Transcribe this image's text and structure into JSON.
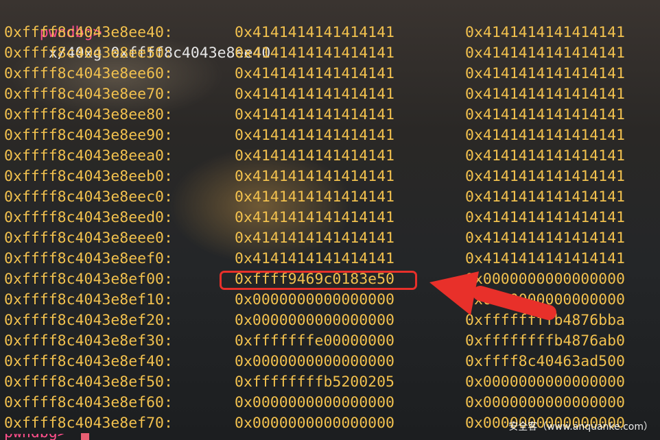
{
  "terminal": {
    "prompt": "pwndbg>",
    "command": "x/40xg 0xffff8c4043e8ee40",
    "rows": [
      {
        "addr": "0xffff8c4043e8ee40:",
        "v1": "0x4141414141414141",
        "v2": "0x4141414141414141"
      },
      {
        "addr": "0xffff8c4043e8ee50:",
        "v1": "0x4141414141414141",
        "v2": "0x4141414141414141"
      },
      {
        "addr": "0xffff8c4043e8ee60:",
        "v1": "0x4141414141414141",
        "v2": "0x4141414141414141"
      },
      {
        "addr": "0xffff8c4043e8ee70:",
        "v1": "0x4141414141414141",
        "v2": "0x4141414141414141"
      },
      {
        "addr": "0xffff8c4043e8ee80:",
        "v1": "0x4141414141414141",
        "v2": "0x4141414141414141"
      },
      {
        "addr": "0xffff8c4043e8ee90:",
        "v1": "0x4141414141414141",
        "v2": "0x4141414141414141"
      },
      {
        "addr": "0xffff8c4043e8eea0:",
        "v1": "0x4141414141414141",
        "v2": "0x4141414141414141"
      },
      {
        "addr": "0xffff8c4043e8eeb0:",
        "v1": "0x4141414141414141",
        "v2": "0x4141414141414141"
      },
      {
        "addr": "0xffff8c4043e8eec0:",
        "v1": "0x4141414141414141",
        "v2": "0x4141414141414141"
      },
      {
        "addr": "0xffff8c4043e8eed0:",
        "v1": "0x4141414141414141",
        "v2": "0x4141414141414141"
      },
      {
        "addr": "0xffff8c4043e8eee0:",
        "v1": "0x4141414141414141",
        "v2": "0x4141414141414141"
      },
      {
        "addr": "0xffff8c4043e8eef0:",
        "v1": "0x4141414141414141",
        "v2": "0x4141414141414141"
      },
      {
        "addr": "0xffff8c4043e8ef00:",
        "v1": "0xffff9469c0183e50",
        "v2": "0x0000000000000000"
      },
      {
        "addr": "0xffff8c4043e8ef10:",
        "v1": "0x0000000000000000",
        "v2": "0x0000000000000000"
      },
      {
        "addr": "0xffff8c4043e8ef20:",
        "v1": "0x0000000000000000",
        "v2": "0xffffffffb4876bba"
      },
      {
        "addr": "0xffff8c4043e8ef30:",
        "v1": "0xfffffffe00000000",
        "v2": "0xffffffffb4876ab0"
      },
      {
        "addr": "0xffff8c4043e8ef40:",
        "v1": "0x0000000000000000",
        "v2": "0xffff8c40463ad500"
      },
      {
        "addr": "0xffff8c4043e8ef50:",
        "v1": "0xffffffffb5200205",
        "v2": "0x0000000000000000"
      },
      {
        "addr": "0xffff8c4043e8ef60:",
        "v1": "0x0000000000000000",
        "v2": "0x0000000000000000"
      },
      {
        "addr": "0xffff8c4043e8ef70:",
        "v1": "0x0000000000000000",
        "v2": "0x0000000000000000"
      }
    ],
    "highlighted_value": "0xffff9469c0183e50",
    "next_prompt_partial": "pwndbg>"
  },
  "annotation": {
    "box_color": "#e8302a",
    "arrow_color": "#e8302a"
  },
  "watermark": {
    "text": "安全客（www.anquanke.com）"
  },
  "colors": {
    "prompt": "#ff4f8b",
    "command": "#e6e6e6",
    "memory_text": "#f2c14e"
  }
}
